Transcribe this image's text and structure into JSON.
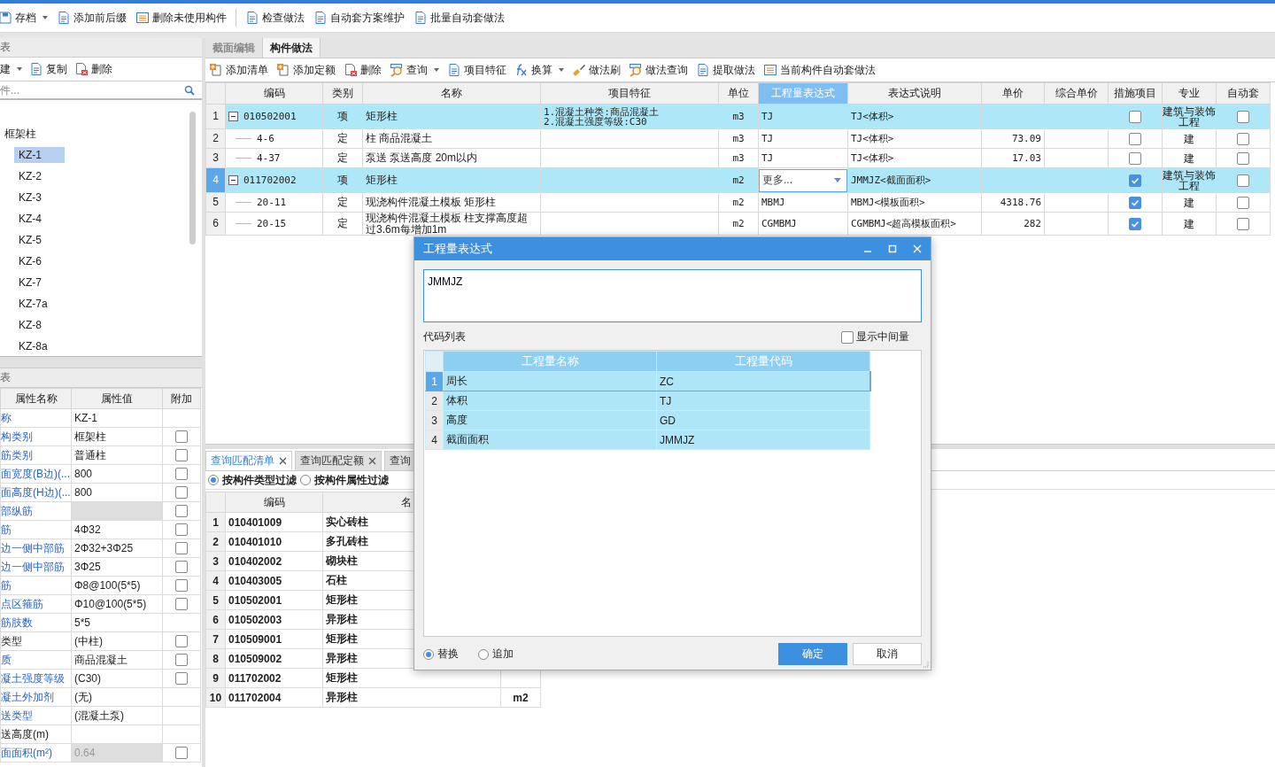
{
  "toolbar": [
    {
      "label": "存档",
      "dropdown": true
    },
    {
      "label": "添加前后缀",
      "dropdown": false
    },
    {
      "label": "删除未使用构件",
      "dropdown": false
    },
    {
      "label": "检查做法",
      "dropdown": false
    },
    {
      "label": "自动套方案维护",
      "dropdown": false
    },
    {
      "label": "批量自动套做法",
      "dropdown": false
    }
  ],
  "component_panel": {
    "title": "表",
    "toolbar": [
      {
        "label": "建",
        "dropdown": true
      },
      {
        "label": "复制",
        "dropdown": false
      },
      {
        "label": "删除",
        "dropdown": false
      }
    ],
    "search": {
      "placeholder": "件..."
    },
    "tree": [
      {
        "label": "框架柱",
        "children": [
          {
            "label": "KZ-1",
            "selected": true
          },
          {
            "label": "KZ-2",
            "selected": false
          },
          {
            "label": "KZ-3",
            "selected": false
          },
          {
            "label": "KZ-4",
            "selected": false
          },
          {
            "label": "KZ-5",
            "selected": false
          },
          {
            "label": "KZ-6",
            "selected": false
          },
          {
            "label": "KZ-7",
            "selected": false
          },
          {
            "label": "KZ-7a",
            "selected": false
          },
          {
            "label": "KZ-8",
            "selected": false
          },
          {
            "label": "KZ-8a",
            "selected": false
          }
        ]
      }
    ]
  },
  "property_panel": {
    "title": "表",
    "columns": [
      "属性名称",
      "属性值",
      "附加"
    ],
    "rows": [
      {
        "name": "称",
        "value": "KZ-1",
        "private": true,
        "disabled": false
      },
      {
        "name": "构类别",
        "value": "框架柱",
        "private": true,
        "disabled": false,
        "checked": false
      },
      {
        "name": "筋类别",
        "value": "普通柱",
        "private": true,
        "disabled": false,
        "checked": false
      },
      {
        "name": "面宽度(B边)(...",
        "value": "800",
        "private": true,
        "disabled": false,
        "checked": false
      },
      {
        "name": "面高度(H边)(...",
        "value": "800",
        "private": true,
        "disabled": false,
        "checked": false
      },
      {
        "name": "部纵筋",
        "value": "",
        "private": true,
        "disabled": true,
        "checked": false
      },
      {
        "name": "筋",
        "value": "4Φ32",
        "private": true,
        "disabled": false,
        "checked": false
      },
      {
        "name": "边一侧中部筋",
        "value": "2Φ32+3Φ25",
        "private": true,
        "disabled": false,
        "checked": false
      },
      {
        "name": "边一侧中部筋",
        "value": "3Φ25",
        "private": true,
        "disabled": false,
        "checked": false
      },
      {
        "name": "筋",
        "value": "Φ8@100(5*5)",
        "private": true,
        "disabled": false,
        "checked": false
      },
      {
        "name": "点区箍筋",
        "value": "Φ10@100(5*5)",
        "private": true,
        "disabled": false,
        "checked": false
      },
      {
        "name": "筋肢数",
        "value": "5*5",
        "private": true,
        "disabled": false
      },
      {
        "name": "类型",
        "value": "(中柱)",
        "private": false,
        "disabled": false,
        "checked": false
      },
      {
        "name": "质",
        "value": "商品混凝土",
        "private": true,
        "disabled": false,
        "checked": false
      },
      {
        "name": "凝土强度等级",
        "value": "(C30)",
        "private": true,
        "disabled": false,
        "checked": false
      },
      {
        "name": "凝土外加剂",
        "value": "(无)",
        "private": true,
        "disabled": false
      },
      {
        "name": "送类型",
        "value": "(混凝土泵)",
        "private": true,
        "disabled": false
      },
      {
        "name": "送高度(m)",
        "value": "",
        "private": false,
        "disabled": false
      },
      {
        "name": "面面积(m²)",
        "value": "0.64",
        "private": true,
        "disabled": true,
        "checked": false
      }
    ]
  },
  "method_tabs": [
    {
      "label": "截面编辑",
      "selected": false
    },
    {
      "label": "构件做法",
      "selected": true
    }
  ],
  "method_toolbar": [
    {
      "label": "添加清单",
      "dropdown": false
    },
    {
      "label": "添加定额",
      "dropdown": false
    },
    {
      "label": "删除",
      "dropdown": false
    },
    {
      "label": "查询",
      "dropdown": true
    },
    {
      "label": "项目特征",
      "dropdown": false
    },
    {
      "label": "换算",
      "dropdown": true
    },
    {
      "label": "做法刷",
      "dropdown": false
    },
    {
      "label": "做法查询",
      "dropdown": false
    },
    {
      "label": "提取做法",
      "dropdown": false
    },
    {
      "label": "当前构件自动套做法",
      "dropdown": false
    }
  ],
  "method_table": {
    "columns": [
      {
        "label": "编码",
        "selected": false
      },
      {
        "label": "类别",
        "selected": false
      },
      {
        "label": "名称",
        "selected": false
      },
      {
        "label": "项目特征",
        "selected": false
      },
      {
        "label": "单位",
        "selected": false
      },
      {
        "label": "工程量表达式",
        "selected": true
      },
      {
        "label": "表达式说明",
        "selected": false
      },
      {
        "label": "单价",
        "selected": false
      },
      {
        "label": "综合单价",
        "selected": false
      },
      {
        "label": "措施项目",
        "selected": false
      },
      {
        "label": "专业",
        "selected": false
      },
      {
        "label": "自动套",
        "selected": false
      }
    ],
    "rows": [
      {
        "num": "1",
        "kind": "list",
        "expanded": true,
        "selected": false,
        "code": "010502001",
        "type": "项",
        "name": "矩形柱",
        "feature": "1.混凝土种类:商品混凝土\n2.混凝土强度等级:C30",
        "unit": "m3",
        "expr": "TJ",
        "editing": false,
        "desc": "TJ<体积>",
        "measure": false,
        "specialty": "建筑与装饰工程",
        "auto": false
      },
      {
        "num": "2",
        "kind": "quota",
        "selected": false,
        "code": "4-6",
        "type": "定",
        "name": "柱 商品混凝土",
        "unit": "m3",
        "expr": "TJ",
        "editing": false,
        "desc": "TJ<体积>",
        "price": "73.09",
        "measure": false,
        "specialty": "建",
        "auto": false
      },
      {
        "num": "3",
        "kind": "quota",
        "selected": false,
        "code": "4-37",
        "type": "定",
        "name": "泵送 泵送高度 20m以内",
        "unit": "m3",
        "expr": "TJ",
        "editing": false,
        "desc": "TJ<体积>",
        "price": "17.03",
        "measure": false,
        "specialty": "建",
        "auto": false
      },
      {
        "num": "4",
        "kind": "list",
        "expanded": true,
        "selected": true,
        "code": "011702002",
        "type": "项",
        "name": "矩形柱",
        "unit": "m2",
        "expr": "更多...",
        "editing": true,
        "desc": "JMMJZ<截面面积>",
        "measure": true,
        "specialty": "建筑与装饰工程",
        "auto": false
      },
      {
        "num": "5",
        "kind": "quota",
        "selected": false,
        "code": "20-11",
        "type": "定",
        "name": "现浇构件混凝土模板 矩形柱",
        "unit": "m2",
        "expr": "MBMJ",
        "editing": false,
        "desc": "MBMJ<模板面积>",
        "price": "4318.76",
        "measure": true,
        "specialty": "建",
        "auto": false
      },
      {
        "num": "6",
        "kind": "quota",
        "selected": false,
        "code": "20-15",
        "type": "定",
        "name": "现浇构件混凝土模板 柱支撑高度超过3.6m每增加1m",
        "unit": "m2",
        "expr": "CGMBMJ",
        "editing": false,
        "desc": "CGMBMJ<超高模板面积>",
        "price": "282",
        "measure": true,
        "specialty": "建",
        "auto": false
      }
    ]
  },
  "query_panel": {
    "tabs": [
      {
        "label": "查询匹配清单",
        "selected": true,
        "closable": true
      },
      {
        "label": "查询匹配定额",
        "selected": false,
        "closable": true
      },
      {
        "label": "查询",
        "selected": false,
        "closable": false
      }
    ],
    "filters": [
      {
        "label": "按构件类型过滤",
        "selected": true
      },
      {
        "label": "按构件属性过滤",
        "selected": false
      }
    ],
    "columns": [
      "编码",
      "名"
    ],
    "rows": [
      {
        "num": "1",
        "code": "010401009",
        "name": "实心砖柱"
      },
      {
        "num": "2",
        "code": "010401010",
        "name": "多孔砖柱"
      },
      {
        "num": "3",
        "code": "010402002",
        "name": "砌块柱"
      },
      {
        "num": "4",
        "code": "010403005",
        "name": "石柱"
      },
      {
        "num": "5",
        "code": "010502001",
        "name": "矩形柱"
      },
      {
        "num": "6",
        "code": "010502003",
        "name": "异形柱"
      },
      {
        "num": "7",
        "code": "010509001",
        "name": "矩形柱"
      },
      {
        "num": "8",
        "code": "010509002",
        "name": "异形柱"
      },
      {
        "num": "9",
        "code": "011702002",
        "name": "矩形柱"
      },
      {
        "num": "10",
        "code": "011702004",
        "name": "异形柱",
        "unit": "m2"
      }
    ]
  },
  "dialog": {
    "title": "工程量表达式",
    "expression": "JMMJZ",
    "list_label": "代码列表",
    "show_intermediate": {
      "label": "显示中间量",
      "checked": false
    },
    "columns": [
      "工程量名称",
      "工程量代码"
    ],
    "rows": [
      {
        "num": "1",
        "name": "周长",
        "code": "ZC",
        "selected": true
      },
      {
        "num": "2",
        "name": "体积",
        "code": "TJ",
        "selected": false
      },
      {
        "num": "3",
        "name": "高度",
        "code": "GD",
        "selected": false
      },
      {
        "num": "4",
        "name": "截面面积",
        "code": "JMMJZ",
        "selected": false
      }
    ],
    "modes": [
      {
        "label": "替换",
        "selected": true
      },
      {
        "label": "追加",
        "selected": false
      }
    ],
    "buttons": [
      {
        "label": "确定",
        "primary": true
      },
      {
        "label": "取消",
        "primary": false
      }
    ]
  }
}
